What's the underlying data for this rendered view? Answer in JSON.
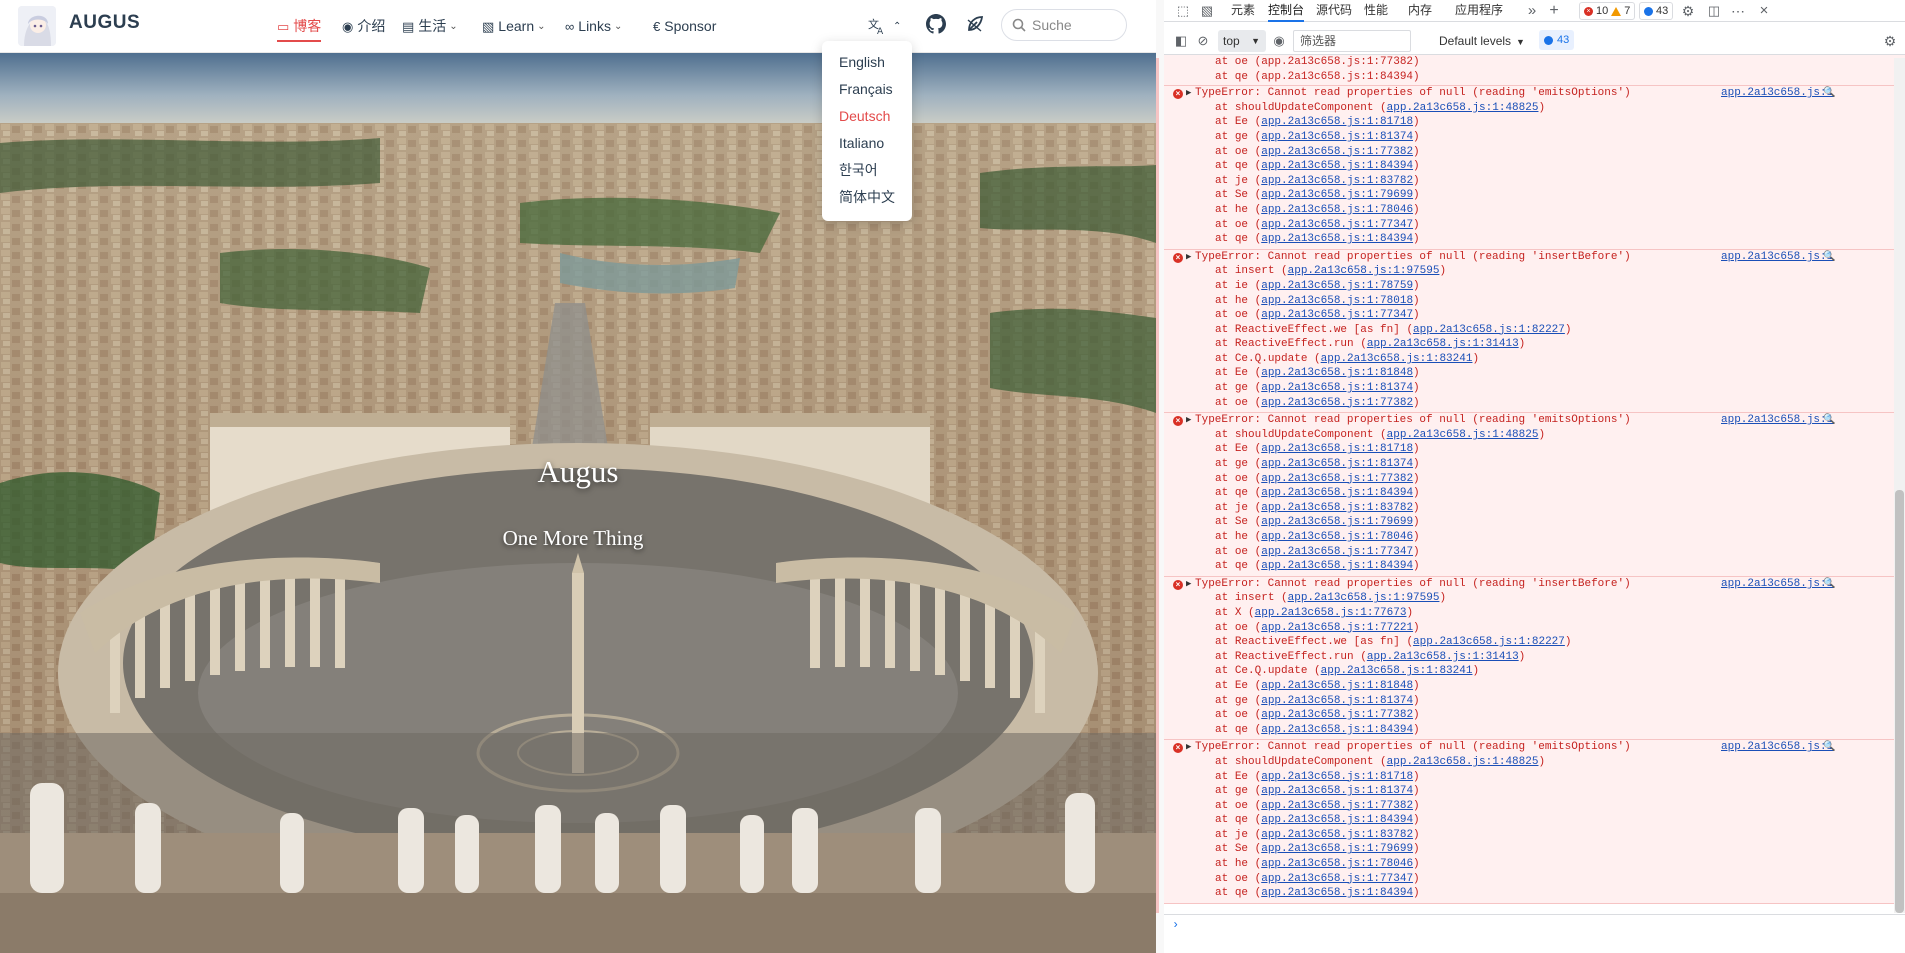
{
  "site": {
    "brand": "AUGUS",
    "nav": [
      {
        "label": "博客",
        "icon": "book-icon",
        "active": true
      },
      {
        "label": "介绍",
        "icon": "medal-icon"
      },
      {
        "label": "生活",
        "icon": "bed-icon",
        "dropdown": true
      },
      {
        "label": "Learn",
        "icon": "book-stack-icon",
        "dropdown": true
      },
      {
        "label": "Links",
        "icon": "bicycle-icon",
        "dropdown": true
      },
      {
        "label": "Sponsor",
        "icon": "euro-icon"
      }
    ],
    "search_placeholder": "Suche",
    "languages": [
      "English",
      "Français",
      "Deutsch",
      "Italiano",
      "한국어",
      "简体中文"
    ],
    "selected_language": "Deutsch",
    "hero_title": "Augus",
    "hero_subtitle": "One More Thing",
    "accent": "#e34b4b"
  },
  "devtools": {
    "tabs": [
      "元素",
      "控制台",
      "源代码",
      "性能",
      "内存",
      "应用程序"
    ],
    "active_tab": "控制台",
    "errors": "10",
    "warnings": "7",
    "info": "43",
    "context": "top",
    "filter_placeholder": "筛选器",
    "levels": "Default levels",
    "message_count": "43",
    "trail": [
      "at oe (app.2a13c658.js:1:77382)",
      "at qe (app.2a13c658.js:1:84394)"
    ],
    "messages": [
      {
        "text": "TypeError: Cannot read properties of null (reading 'emitsOptions')",
        "source": "app.2a13c658.js:1",
        "frames": [
          [
            "shouldUpdateComponent",
            "app.2a13c658.js:1:48825"
          ],
          [
            "Ee",
            "app.2a13c658.js:1:81718"
          ],
          [
            "ge",
            "app.2a13c658.js:1:81374"
          ],
          [
            "oe",
            "app.2a13c658.js:1:77382"
          ],
          [
            "qe",
            "app.2a13c658.js:1:84394"
          ],
          [
            "je",
            "app.2a13c658.js:1:83782"
          ],
          [
            "Se",
            "app.2a13c658.js:1:79699"
          ],
          [
            "he",
            "app.2a13c658.js:1:78046"
          ],
          [
            "oe",
            "app.2a13c658.js:1:77347"
          ],
          [
            "qe",
            "app.2a13c658.js:1:84394"
          ]
        ]
      },
      {
        "text": "TypeError: Cannot read properties of null (reading 'insertBefore')",
        "source": "app.2a13c658.js:1",
        "frames": [
          [
            "insert",
            "app.2a13c658.js:1:97595"
          ],
          [
            "ie",
            "app.2a13c658.js:1:78759"
          ],
          [
            "he",
            "app.2a13c658.js:1:78018"
          ],
          [
            "oe",
            "app.2a13c658.js:1:77347"
          ],
          [
            "ReactiveEffect.we [as fn]",
            "app.2a13c658.js:1:82227"
          ],
          [
            "ReactiveEffect.run",
            "app.2a13c658.js:1:31413"
          ],
          [
            "Ce.Q.update",
            "app.2a13c658.js:1:83241"
          ],
          [
            "Ee",
            "app.2a13c658.js:1:81848"
          ],
          [
            "ge",
            "app.2a13c658.js:1:81374"
          ],
          [
            "oe",
            "app.2a13c658.js:1:77382"
          ]
        ]
      },
      {
        "text": "TypeError: Cannot read properties of null (reading 'emitsOptions')",
        "source": "app.2a13c658.js:1",
        "frames": [
          [
            "shouldUpdateComponent",
            "app.2a13c658.js:1:48825"
          ],
          [
            "Ee",
            "app.2a13c658.js:1:81718"
          ],
          [
            "ge",
            "app.2a13c658.js:1:81374"
          ],
          [
            "oe",
            "app.2a13c658.js:1:77382"
          ],
          [
            "qe",
            "app.2a13c658.js:1:84394"
          ],
          [
            "je",
            "app.2a13c658.js:1:83782"
          ],
          [
            "Se",
            "app.2a13c658.js:1:79699"
          ],
          [
            "he",
            "app.2a13c658.js:1:78046"
          ],
          [
            "oe",
            "app.2a13c658.js:1:77347"
          ],
          [
            "qe",
            "app.2a13c658.js:1:84394"
          ]
        ]
      },
      {
        "text": "TypeError: Cannot read properties of null (reading 'insertBefore')",
        "source": "app.2a13c658.js:1",
        "frames": [
          [
            "insert",
            "app.2a13c658.js:1:97595"
          ],
          [
            "X",
            "app.2a13c658.js:1:77673"
          ],
          [
            "oe",
            "app.2a13c658.js:1:77221"
          ],
          [
            "ReactiveEffect.we [as fn]",
            "app.2a13c658.js:1:82227"
          ],
          [
            "ReactiveEffect.run",
            "app.2a13c658.js:1:31413"
          ],
          [
            "Ce.Q.update",
            "app.2a13c658.js:1:83241"
          ],
          [
            "Ee",
            "app.2a13c658.js:1:81848"
          ],
          [
            "ge",
            "app.2a13c658.js:1:81374"
          ],
          [
            "oe",
            "app.2a13c658.js:1:77382"
          ],
          [
            "qe",
            "app.2a13c658.js:1:84394"
          ]
        ]
      },
      {
        "text": "TypeError: Cannot read properties of null (reading 'emitsOptions')",
        "source": "app.2a13c658.js:1",
        "frames": [
          [
            "shouldUpdateComponent",
            "app.2a13c658.js:1:48825"
          ],
          [
            "Ee",
            "app.2a13c658.js:1:81718"
          ],
          [
            "ge",
            "app.2a13c658.js:1:81374"
          ],
          [
            "oe",
            "app.2a13c658.js:1:77382"
          ],
          [
            "qe",
            "app.2a13c658.js:1:84394"
          ],
          [
            "je",
            "app.2a13c658.js:1:83782"
          ],
          [
            "Se",
            "app.2a13c658.js:1:79699"
          ],
          [
            "he",
            "app.2a13c658.js:1:78046"
          ],
          [
            "oe",
            "app.2a13c658.js:1:77347"
          ],
          [
            "qe",
            "app.2a13c658.js:1:84394"
          ]
        ]
      }
    ]
  }
}
